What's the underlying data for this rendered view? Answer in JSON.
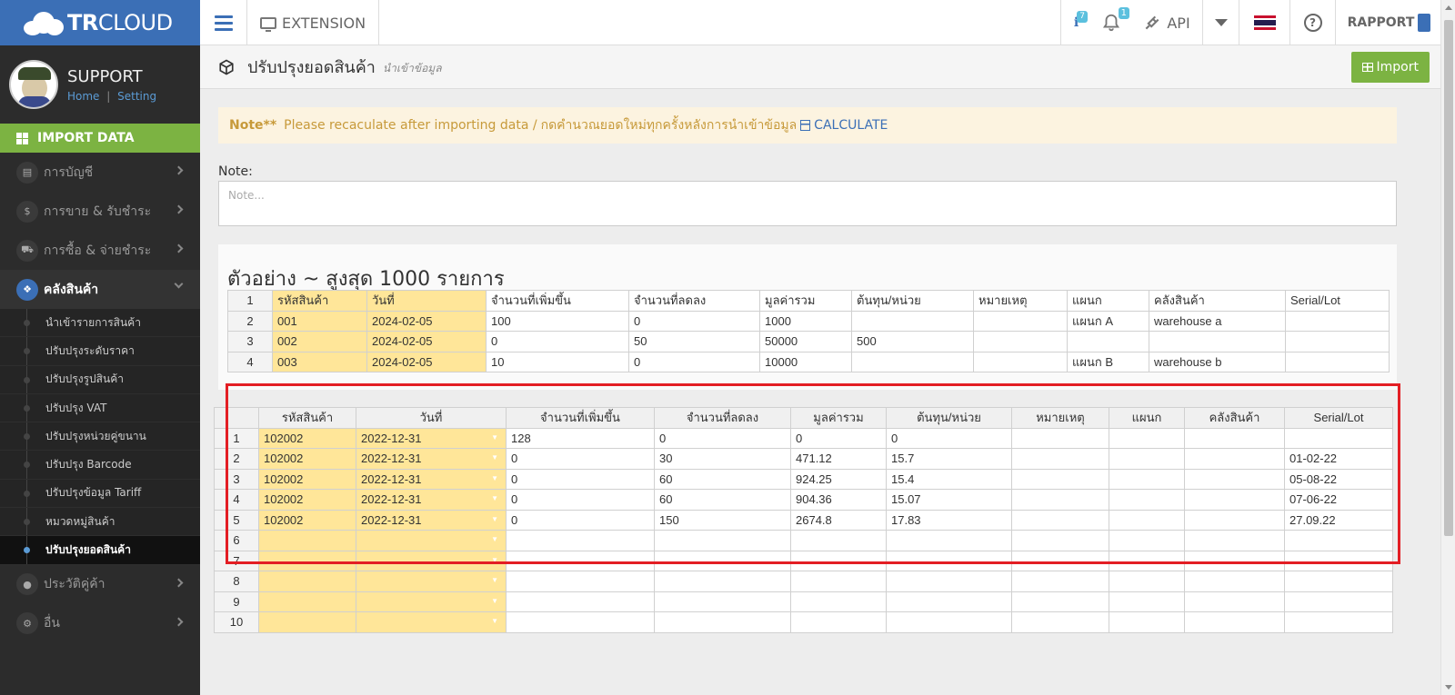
{
  "brand": {
    "logo_bold": "TR",
    "logo_rest": "CLOUD"
  },
  "topbar": {
    "extension_label": "EXTENSION",
    "info_badge": "7",
    "notif_badge": "1",
    "api_label": "API",
    "help_symbol": "?",
    "rapport_label": "RAPPORT"
  },
  "sidebar": {
    "user_name": "SUPPORT",
    "home_link": "Home",
    "sep": "|",
    "setting_link": "Setting",
    "import_data": "IMPORT DATA",
    "menu": [
      {
        "label": "การบัญชี",
        "icon": "book-icon"
      },
      {
        "label": "การขาย & รับชำระ",
        "icon": "dollar-icon"
      },
      {
        "label": "การซื้อ & จ่ายชำระ",
        "icon": "cart-icon"
      },
      {
        "label": "คลังสินค้า",
        "icon": "cubes-icon"
      }
    ],
    "sub_items": [
      "นำเข้ารายการสินค้า",
      "ปรับปรุงระดับราคา",
      "ปรับปรุงรูปสินค้า",
      "ปรับปรุง VAT",
      "ปรับปรุงหน่วยคู่ขนาน",
      "ปรับปรุง Barcode",
      "ปรับปรุงข้อมูล Tariff",
      "หมวดหมู่สินค้า",
      "ปรับปรุงยอดสินค้า"
    ],
    "menu_bottom": [
      {
        "label": "ประวัติคู่ค้า",
        "icon": "user-icon"
      },
      {
        "label": "อื่น",
        "icon": "cog-icon"
      }
    ]
  },
  "page": {
    "title": "ปรับปรุงยอดสินค้า",
    "subtitle": "นำเข้าข้อมูล",
    "import_button": "Import"
  },
  "banner": {
    "note_bold": "Note**",
    "text_en": "Please recaculate after importing data /",
    "text_th": "กดคำนวณยอดใหม่ทุกครั้งหลังการนำเข้าข้อมูล",
    "calc_link": "CALCULATE"
  },
  "note": {
    "label": "Note:",
    "placeholder": "Note...",
    "value": ""
  },
  "example": {
    "title": "ตัวอย่าง ~ สูงสุด 1000 รายการ",
    "rows": [
      [
        "1",
        "รหัสสินค้า",
        "วันที่",
        "จำนวนที่เพิ่มขึ้น",
        "จำนวนที่ลดลง",
        "มูลค่ารวม",
        "ต้นทุน/หน่วย",
        "หมายเหตุ",
        "แผนก",
        "คลังสินค้า",
        "Serial/Lot"
      ],
      [
        "2",
        "001",
        "2024-02-05",
        "100",
        "0",
        "1000",
        "",
        "",
        "แผนก A",
        "warehouse a",
        ""
      ],
      [
        "3",
        "002",
        "2024-02-05",
        "0",
        "50",
        "50000",
        "500",
        "",
        "",
        "",
        ""
      ],
      [
        "4",
        "003",
        "2024-02-05",
        "10",
        "0",
        "10000",
        "",
        "",
        "แผนก B",
        "warehouse b",
        ""
      ]
    ]
  },
  "grid": {
    "headers": [
      "",
      "รหัสสินค้า",
      "วันที่",
      "จำนวนที่เพิ่มขึ้น",
      "จำนวนที่ลดลง",
      "มูลค่ารวม",
      "ต้นทุน/หน่วย",
      "หมายเหตุ",
      "แผนก",
      "คลังสินค้า",
      "Serial/Lot"
    ],
    "rows": [
      [
        "1",
        "102002",
        "2022-12-31",
        "128",
        "0",
        "0",
        "0",
        "",
        "",
        "",
        ""
      ],
      [
        "2",
        "102002",
        "2022-12-31",
        "0",
        "30",
        "471.12",
        "15.7",
        "",
        "",
        "",
        "01-02-22"
      ],
      [
        "3",
        "102002",
        "2022-12-31",
        "0",
        "60",
        "924.25",
        "15.4",
        "",
        "",
        "",
        "05-08-22"
      ],
      [
        "4",
        "102002",
        "2022-12-31",
        "0",
        "60",
        "904.36",
        "15.07",
        "",
        "",
        "",
        "07-06-22"
      ],
      [
        "5",
        "102002",
        "2022-12-31",
        "0",
        "150",
        "2674.8",
        "17.83",
        "",
        "",
        "",
        "27.09.22"
      ],
      [
        "6",
        "",
        "",
        "",
        "",
        "",
        "",
        "",
        "",
        "",
        ""
      ],
      [
        "7",
        "",
        "",
        "",
        "",
        "",
        "",
        "",
        "",
        "",
        ""
      ],
      [
        "8",
        "",
        "",
        "",
        "",
        "",
        "",
        "",
        "",
        "",
        ""
      ],
      [
        "9",
        "",
        "",
        "",
        "",
        "",
        "",
        "",
        "",
        "",
        ""
      ],
      [
        "10",
        "",
        "",
        "",
        "",
        "",
        "",
        "",
        "",
        "",
        ""
      ]
    ]
  },
  "colors": {
    "brand_blue": "#3b6fb6",
    "import_green": "#7cb342",
    "highlight_red": "#e31e24",
    "yellow_cell": "#ffe699"
  }
}
